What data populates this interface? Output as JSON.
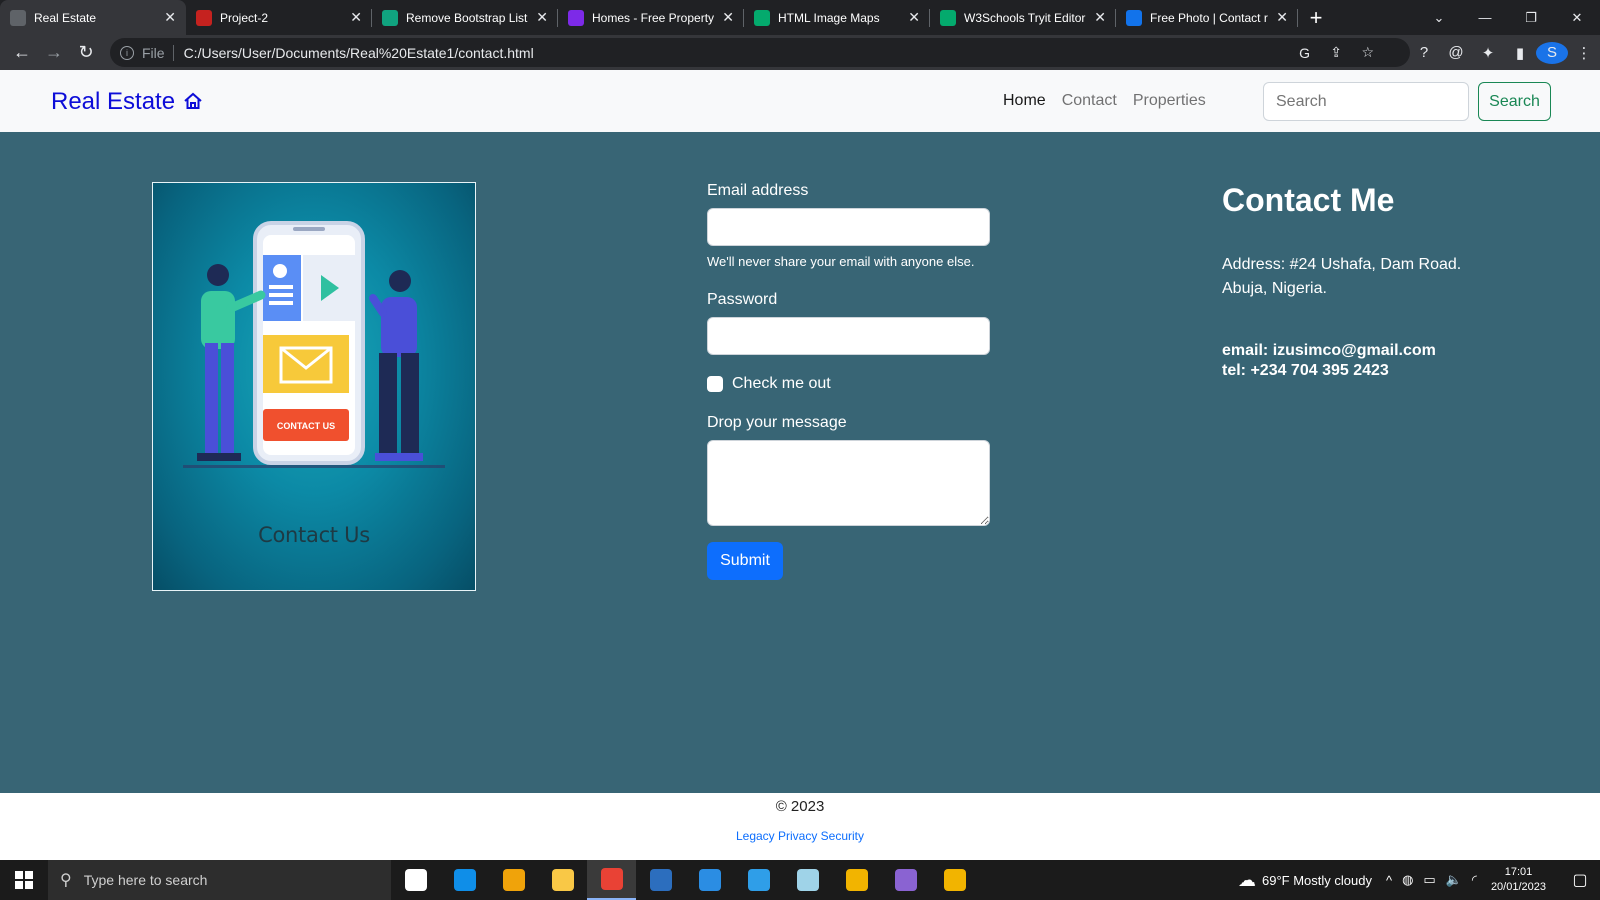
{
  "browser": {
    "tabs": [
      {
        "title": "Real Estate",
        "favicon": "globe-icon",
        "color": "#5f6368",
        "active": true
      },
      {
        "title": "Project-2",
        "favicon": "project-icon",
        "color": "#c5221f",
        "active": false
      },
      {
        "title": "Remove Bootstrap List I",
        "favicon": "openai-icon",
        "color": "#10a37f",
        "active": false
      },
      {
        "title": "Homes - Free Property",
        "favicon": "canva-icon",
        "color": "#7d2ae8",
        "active": false
      },
      {
        "title": "HTML Image Maps",
        "favicon": "w3schools-icon",
        "color": "#04aa6d",
        "active": false
      },
      {
        "title": "W3Schools Tryit Editor",
        "favicon": "w3schools-icon",
        "color": "#04aa6d",
        "active": false
      },
      {
        "title": "Free Photo | Contact re",
        "favicon": "freepik-icon",
        "color": "#1273eb",
        "active": false
      }
    ],
    "url": "C:/Users/User/Documents/Real%20Estate1/contact.html",
    "file_label": "File",
    "profile_initial": "S"
  },
  "site": {
    "brand": "Real Estate",
    "nav": [
      "Home",
      "Contact",
      "Properties"
    ],
    "search": {
      "placeholder": "Search",
      "button": "Search"
    }
  },
  "illustration": {
    "caption": "Contact Us",
    "button_text": "CONTACT US"
  },
  "form": {
    "email_label": "Email address",
    "email_help": "We'll never share your email with anyone else.",
    "password_label": "Password",
    "check_label": "Check me out",
    "message_label": "Drop your message",
    "submit": "Submit"
  },
  "contact": {
    "heading": "Contact Me",
    "address_line1": "Address: #24 Ushafa, Dam Road.",
    "address_line2": "Abuja, Nigeria.",
    "email": "email: izusimco@gmail.com",
    "tel": "tel: +234 704 395 2423"
  },
  "footer": {
    "copyright": "© 2023",
    "links": "Legacy Privacy Security"
  },
  "taskbar": {
    "search_placeholder": "Type here to search",
    "apps": [
      {
        "name": "task-view-icon",
        "color": "#ffffff",
        "active": false
      },
      {
        "name": "edge-icon",
        "color": "#0f8ee8",
        "active": false
      },
      {
        "name": "store-icon",
        "color": "#f0a30a",
        "active": false
      },
      {
        "name": "file-explorer-icon",
        "color": "#f9c846",
        "active": false
      },
      {
        "name": "chrome-icon",
        "color": "#e94235",
        "active": true
      },
      {
        "name": "css3-icon",
        "color": "#2c6ebe",
        "active": false
      },
      {
        "name": "mail-icon",
        "color": "#2b8de3",
        "active": false
      },
      {
        "name": "vscode-icon",
        "color": "#2f9ee8",
        "active": false
      },
      {
        "name": "notepad-icon",
        "color": "#9fd3e8",
        "active": false
      },
      {
        "name": "shield-icon",
        "color": "#f2b400",
        "active": false
      },
      {
        "name": "github-icon",
        "color": "#8a63d2",
        "active": false
      },
      {
        "name": "shield-icon",
        "color": "#f2b400",
        "active": false
      }
    ],
    "weather": "69°F  Mostly cloudy",
    "time": "17:01",
    "date": "20/01/2023"
  }
}
